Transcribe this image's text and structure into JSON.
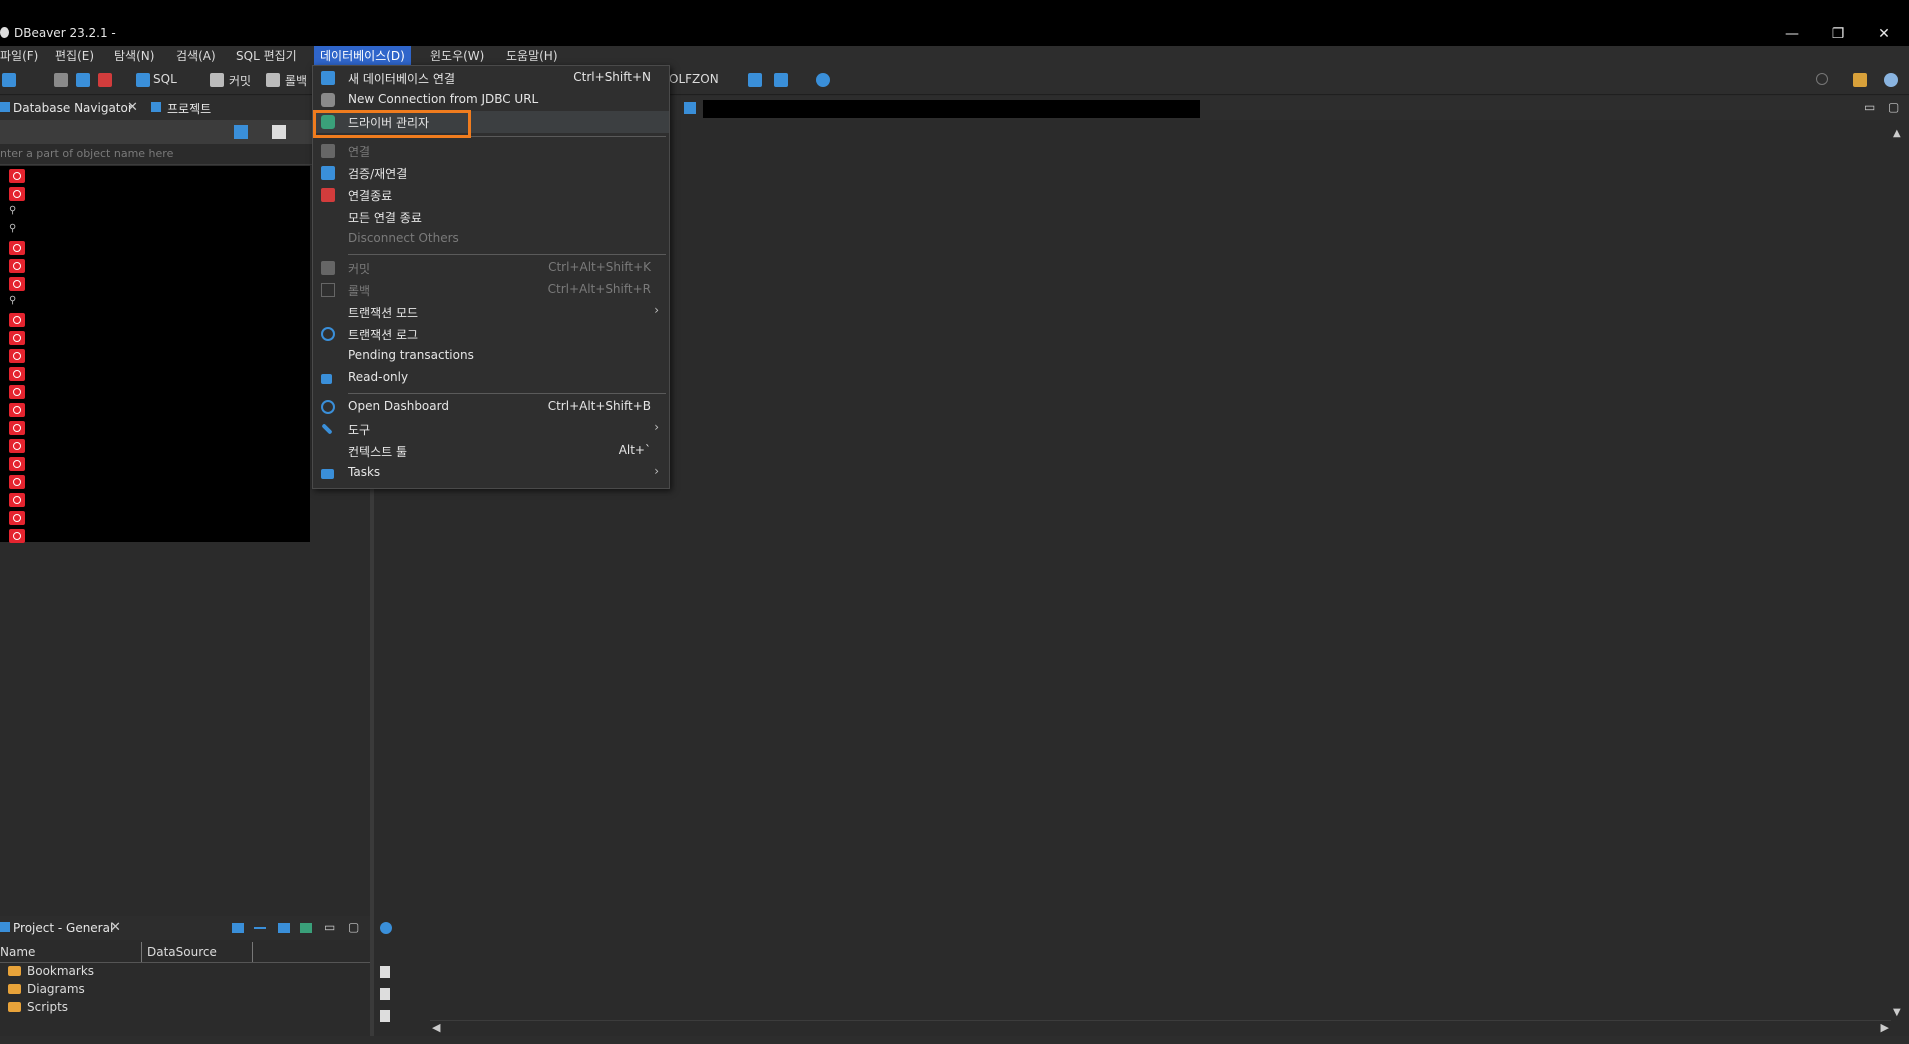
{
  "window": {
    "title": "DBeaver 23.2.1 -",
    "minimize": "—",
    "maximize": "❐",
    "close": "✕"
  },
  "menubar": {
    "items": [
      "파일(F)",
      "편집(E)",
      "탐색(N)",
      "검색(A)",
      "SQL 편집기",
      "데이터베이스(D)",
      "윈도우(W)",
      "도움말(H)"
    ],
    "active_index": 5
  },
  "toolbar": {
    "sql_label": "SQL",
    "commit_label": "커밋",
    "rollback_label": "롤백",
    "connection_label": "OLFZON"
  },
  "left_panel": {
    "nav_tab": "Database Navigator",
    "project_tab": "프로젝트",
    "filter_placeholder": "nter a part of object name here"
  },
  "project_panel": {
    "tab": "Project - General",
    "columns": [
      "Name",
      "DataSource"
    ],
    "rows": [
      "Bookmarks",
      "Diagrams",
      "Scripts"
    ]
  },
  "dropdown": {
    "items": [
      {
        "label": "새 데이터베이스 연결",
        "shortcut": "Ctrl+Shift+N",
        "icon": "new-connection-icon",
        "disabled": false
      },
      {
        "label": "New Connection from JDBC URL",
        "shortcut": "",
        "icon": "database-icon",
        "disabled": false
      },
      {
        "label": "드라이버 관리자",
        "shortcut": "",
        "icon": "driver-manager-icon",
        "disabled": false
      },
      {
        "label": "연결",
        "shortcut": "",
        "icon": "connect-icon",
        "disabled": true
      },
      {
        "label": "검증/재연결",
        "shortcut": "",
        "icon": "reconnect-icon",
        "disabled": false
      },
      {
        "label": "연결종료",
        "shortcut": "",
        "icon": "disconnect-icon",
        "disabled": false
      },
      {
        "label": "모든 연결 종료",
        "shortcut": "",
        "icon": "",
        "disabled": false
      },
      {
        "label": "Disconnect Others",
        "shortcut": "",
        "icon": "",
        "disabled": true
      },
      {
        "label": "커밋",
        "shortcut": "Ctrl+Alt+Shift+K",
        "icon": "commit-icon",
        "disabled": true
      },
      {
        "label": "롤백",
        "shortcut": "Ctrl+Alt+Shift+R",
        "icon": "rollback-icon",
        "disabled": true
      },
      {
        "label": "트랜잭션 모드",
        "shortcut": "",
        "icon": "",
        "disabled": false,
        "submenu": true
      },
      {
        "label": "트랜잭션 로그",
        "shortcut": "",
        "icon": "history-icon",
        "disabled": false
      },
      {
        "label": "Pending transactions",
        "shortcut": "",
        "icon": "",
        "disabled": false
      },
      {
        "label": "Read-only",
        "shortcut": "",
        "icon": "lock-icon",
        "disabled": false
      },
      {
        "label": "Open Dashboard",
        "shortcut": "Ctrl+Alt+Shift+B",
        "icon": "dashboard-icon",
        "disabled": false
      },
      {
        "label": "도구",
        "shortcut": "",
        "icon": "tools-icon",
        "disabled": false,
        "submenu": true
      },
      {
        "label": "컨텍스트 툴",
        "shortcut": "Alt+`",
        "icon": "",
        "disabled": false
      },
      {
        "label": "Tasks",
        "shortcut": "",
        "icon": "tasks-icon",
        "disabled": false,
        "submenu": true
      }
    ],
    "highlighted_index": 2
  }
}
